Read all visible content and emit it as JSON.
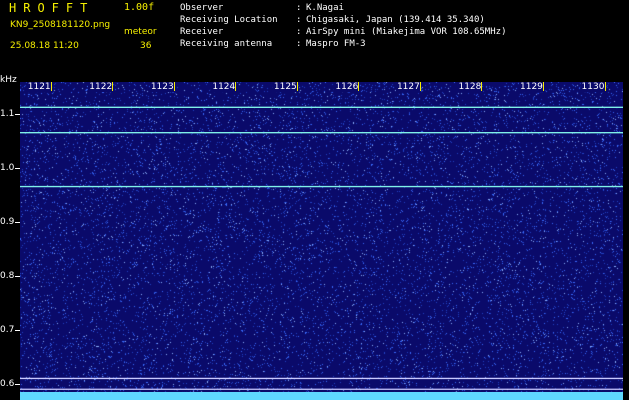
{
  "header": {
    "logo": "HROFFT",
    "version": "1.00f",
    "filename": "KN9_2508181120.png",
    "meteor_label": "meteor",
    "datetime": "25.08.18 11:20",
    "meteor_count": "36",
    "info": [
      {
        "label": "Observer",
        "colon": ":",
        "value": "K.Nagai"
      },
      {
        "label": "Receiving Location",
        "colon": ":",
        "value": "Chigasaki, Japan (139.414 35.340)"
      },
      {
        "label": "Receiver",
        "colon": ":",
        "value": "AirSpy mini (Miakejima VOR 108.65MHz)"
      },
      {
        "label": "Receiving antenna",
        "colon": ":",
        "value": "Maspro FM-3"
      }
    ]
  },
  "chart_data": {
    "type": "heatmap",
    "ylabel": "kHz",
    "y_ticks": [
      "1.1",
      "1.0",
      "0.9",
      "0.8",
      "0.7",
      "0.6"
    ],
    "x_ticks": [
      "1121",
      "1122",
      "1123",
      "1124",
      "1125",
      "1126",
      "1127",
      "1128",
      "1129",
      "1130"
    ],
    "ylim": [
      0.57,
      1.16
    ],
    "xlim": [
      1120.5,
      1130.3
    ],
    "horizontal_signals_khz": [
      1.113,
      1.066,
      0.966,
      0.61,
      0.59
    ],
    "colors": {
      "background": "#0a0a6a",
      "noise": "#3a6cff",
      "signal": "#7ff0e8",
      "bottom_band": "#5fd8ff",
      "text_yellow": "#f6f000"
    }
  }
}
